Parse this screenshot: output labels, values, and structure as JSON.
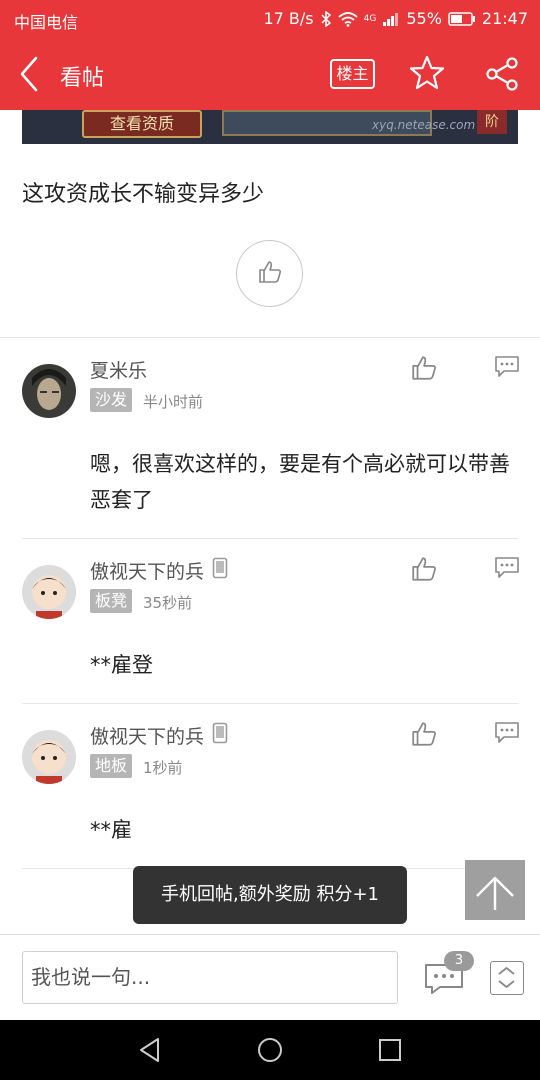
{
  "status_bar": {
    "carrier": "中国电信",
    "speed": "17 B/s",
    "network": "4G",
    "battery": "55%",
    "time": "21:47"
  },
  "app_bar": {
    "title": "看帖",
    "owner_label": "楼主",
    "icons": [
      "back-icon",
      "star-icon",
      "share-icon"
    ]
  },
  "banner": {
    "button_label": "查看资质",
    "url_text": "xyq.netease.com",
    "badge_text": "阶"
  },
  "post": {
    "body": "这攻资成长不输变异多少"
  },
  "comments": [
    {
      "author": "夏米乐",
      "floor": "沙发",
      "time": "半小时前",
      "body": "嗯，很喜欢这样的，要是有个高必就可以带善恶套了",
      "mobile": false
    },
    {
      "author": "傲视天下的兵",
      "floor": "板凳",
      "time": "35秒前",
      "body": "**雇登",
      "mobile": true
    },
    {
      "author": "傲视天下的兵",
      "floor": "地板",
      "time": "1秒前",
      "body": "**雇",
      "mobile": true
    }
  ],
  "toast": "手机回帖,额外奖励 积分+1",
  "bottom_bar": {
    "input_placeholder": "我也说一句...",
    "comment_count": "3"
  },
  "colors": {
    "brand": "#e8373a",
    "toast_bg": "#333333"
  }
}
